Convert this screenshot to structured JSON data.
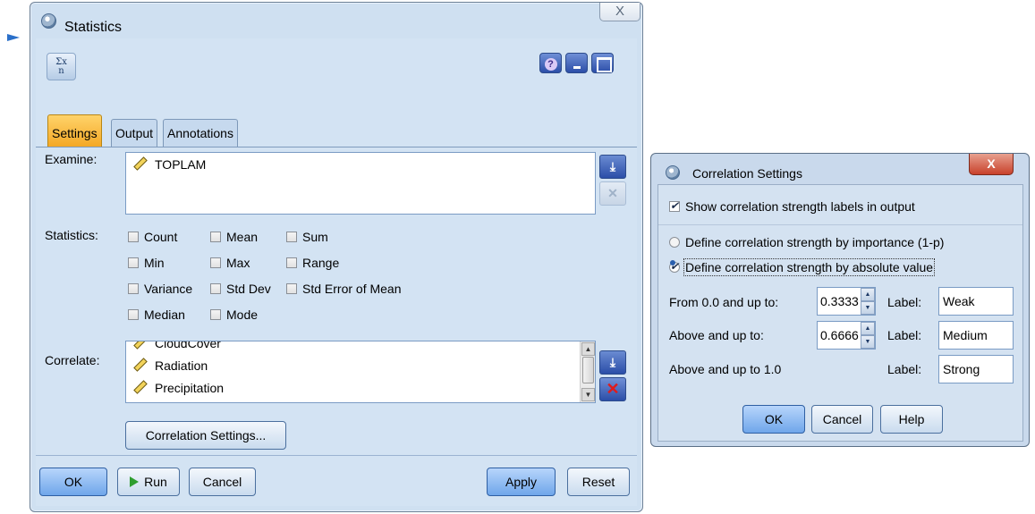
{
  "stats_window": {
    "title": "Statistics",
    "close_glyph": "X",
    "tabs": [
      "Settings",
      "Output",
      "Annotations"
    ],
    "examine_label": "Examine:",
    "examine_fields": [
      "TOPLAM"
    ],
    "statistics_label": "Statistics:",
    "statistics": [
      {
        "label": "Count",
        "checked": false
      },
      {
        "label": "Mean",
        "checked": false
      },
      {
        "label": "Sum",
        "checked": false
      },
      {
        "label": "Min",
        "checked": false
      },
      {
        "label": "Max",
        "checked": false
      },
      {
        "label": "Range",
        "checked": false
      },
      {
        "label": "Variance",
        "checked": false
      },
      {
        "label": "Std Dev",
        "checked": false
      },
      {
        "label": "Std Error of Mean",
        "checked": false
      },
      {
        "label": "Median",
        "checked": false
      },
      {
        "label": "Mode",
        "checked": false
      }
    ],
    "correlate_label": "Correlate:",
    "correlate_fields": [
      "CloudCover",
      "Radiation",
      "Precipitation"
    ],
    "correlation_settings_button": "Correlation Settings...",
    "buttons": {
      "ok": "OK",
      "run": "Run",
      "cancel": "Cancel",
      "apply": "Apply",
      "reset": "Reset"
    },
    "help_glyph": "?"
  },
  "corr_dialog": {
    "title": "Correlation Settings",
    "close_glyph": "X",
    "show_labels": {
      "label": "Show correlation strength labels in output",
      "checked": true
    },
    "options": [
      {
        "label": "Define correlation strength by importance (1-p)",
        "selected": false
      },
      {
        "label": "Define correlation strength by absolute value",
        "selected": true
      }
    ],
    "rows": [
      {
        "label": "From 0.0 and up to:",
        "value": "0.3333",
        "label_caption": "Label:",
        "text": "Weak"
      },
      {
        "label": "Above and up to:",
        "value": "0.6666",
        "label_caption": "Label:",
        "text": "Medium"
      },
      {
        "label": "Above and up to 1.0",
        "value": "",
        "label_caption": "Label:",
        "text": "Strong"
      }
    ],
    "buttons": {
      "ok": "OK",
      "cancel": "Cancel",
      "help": "Help"
    }
  }
}
